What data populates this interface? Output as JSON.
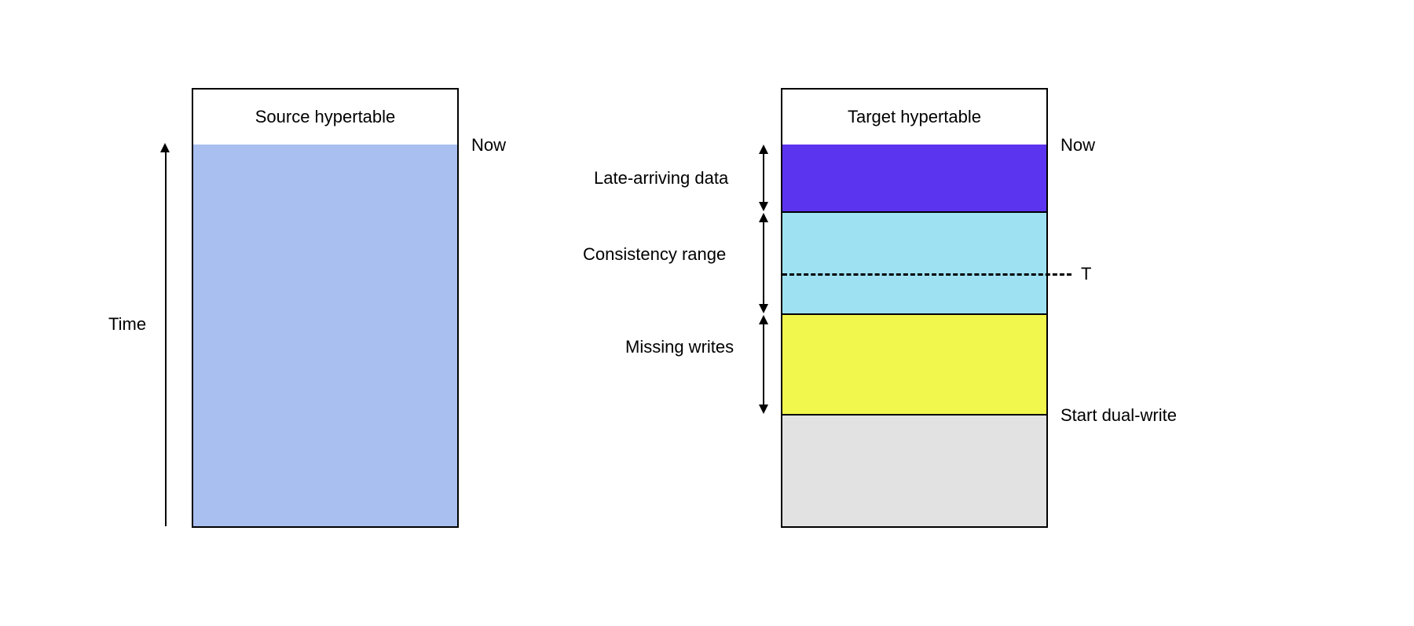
{
  "source": {
    "title": "Source hypertable",
    "labels": {
      "now": "Now",
      "time_axis": "Time"
    },
    "colors": {
      "body": "#a8bff0"
    }
  },
  "target": {
    "title": "Target hypertable",
    "labels": {
      "now": "Now",
      "t": "T",
      "start": "Start dual-write",
      "late": "Late-arriving data",
      "consistency": "Consistency range",
      "missing": "Missing writes"
    },
    "colors": {
      "late": "#5b34f0",
      "consistency": "#9ee1f2",
      "missing": "#f2f74d",
      "empty": "#e2e2e2"
    }
  }
}
